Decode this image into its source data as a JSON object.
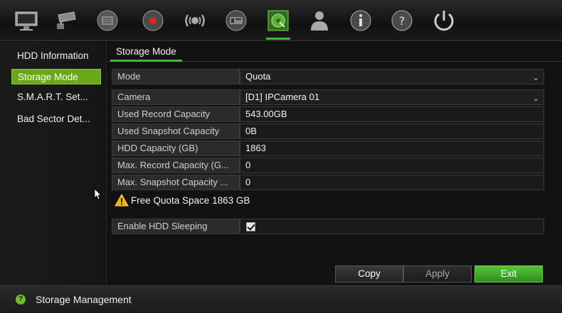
{
  "toolbar": {
    "icons": [
      "monitor-icon",
      "camera-icon",
      "network-icon",
      "record-icon",
      "alarm-icon",
      "device-icon",
      "storage-icon",
      "user-icon",
      "info-icon",
      "help-icon",
      "power-icon"
    ],
    "active": "storage-icon"
  },
  "sidebar": {
    "items": [
      {
        "label": "HDD Information"
      },
      {
        "label": "Storage Mode"
      },
      {
        "label": "S.M.A.R.T. Set..."
      },
      {
        "label": "Bad Sector Det..."
      }
    ]
  },
  "main": {
    "tab": "Storage Mode",
    "rows": [
      {
        "label": "Mode",
        "value": "Quota"
      },
      {
        "label": "Camera",
        "value": "[D1] IPCamera 01"
      },
      {
        "label": "Used Record Capacity",
        "value": "543.00GB"
      },
      {
        "label": "Used Snapshot Capacity",
        "value": "0B"
      },
      {
        "label": "HDD Capacity (GB)",
        "value": "1863"
      },
      {
        "label": "Max. Record Capacity (G...",
        "value": "0"
      },
      {
        "label": "Max. Snapshot Capacity ...",
        "value": "0"
      }
    ],
    "warning": "Free Quota Space 1863 GB",
    "sleep_label": "Enable HDD Sleeping",
    "sleep_checked": true,
    "buttons": {
      "copy": "Copy",
      "apply": "Apply",
      "exit": "Exit"
    }
  },
  "status": {
    "text": "Storage Management"
  },
  "colors": {
    "accent": "#6aa81a",
    "exit": "#3cae2a",
    "tab_underline": "#3cb83c"
  }
}
